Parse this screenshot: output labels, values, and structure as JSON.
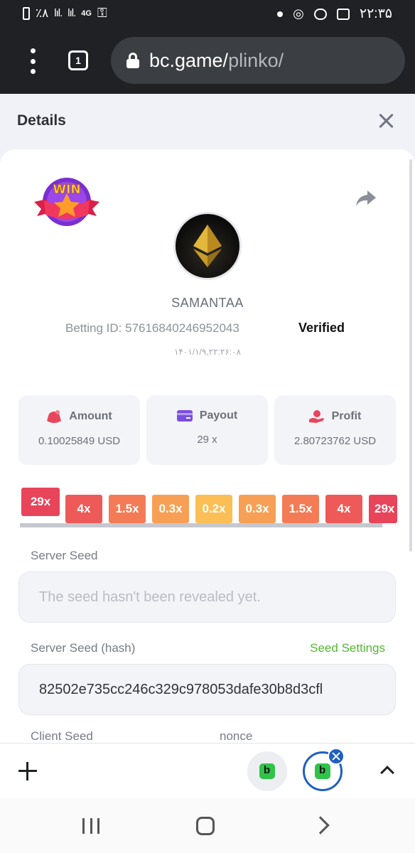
{
  "status_bar": {
    "battery_percent": "٪۸",
    "network": "4G",
    "time": "۲۲:۳۵"
  },
  "browser": {
    "tab_count": "1",
    "url_domain": "bc.game/",
    "url_path": "plinko/"
  },
  "details": {
    "title": "Details"
  },
  "bet": {
    "username": "SAMANTAA",
    "betting_id_label": "Betting ID:",
    "betting_id": "57616840246952043",
    "verified_label": "Verified",
    "datetime": "۱۴۰۱/۱/۹,۲۲:۲۶:۰۸"
  },
  "stats": [
    {
      "label": "Amount",
      "value": "0.10025849 USD",
      "icon": "money-bag-icon",
      "color": "#e8465a"
    },
    {
      "label": "Payout",
      "value": "29 x",
      "icon": "credit-card-icon",
      "color": "#7a4fe0"
    },
    {
      "label": "Profit",
      "value": "2.80723762 USD",
      "icon": "hand-coin-icon",
      "color": "#e8465a"
    }
  ],
  "multipliers": [
    {
      "label": "29x",
      "color": "#e8445a",
      "hit": true
    },
    {
      "label": "4x",
      "color": "#ee5a58",
      "hit": false
    },
    {
      "label": "1.5x",
      "color": "#f37b56",
      "hit": false
    },
    {
      "label": "0.3x",
      "color": "#f7a055",
      "hit": false
    },
    {
      "label": "0.2x",
      "color": "#fbbf55",
      "hit": false
    },
    {
      "label": "0.3x",
      "color": "#f7a055",
      "hit": false
    },
    {
      "label": "1.5x",
      "color": "#f37b56",
      "hit": false
    },
    {
      "label": "4x",
      "color": "#ee5a58",
      "hit": false
    },
    {
      "label": "29x",
      "color": "#e8445a",
      "hit": false
    }
  ],
  "seeds": {
    "server_seed_label": "Server Seed",
    "server_seed_placeholder": "The seed hasn't been revealed yet.",
    "server_seed_hash_label": "Server Seed (hash)",
    "seed_settings_link": "Seed Settings",
    "server_seed_hash": "82502e735cc246c329c978053dafe30b8d3cfl",
    "client_seed_label": "Client Seed",
    "nonce_label": "nonce"
  },
  "colors": {
    "accent_green": "#53b934",
    "tab_active_blue": "#1f5fc0"
  }
}
